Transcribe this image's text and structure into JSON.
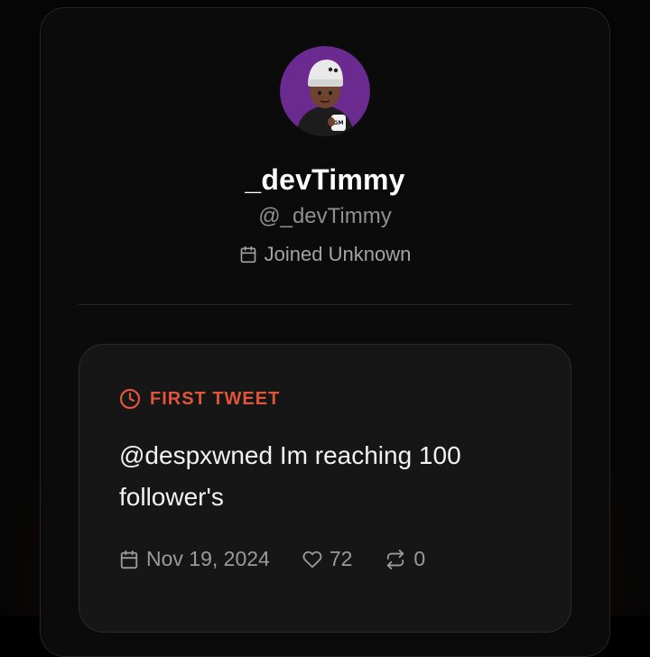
{
  "profile": {
    "display_name": "_devTimmy",
    "handle": "@_devTimmy",
    "joined": "Joined Unknown",
    "avatar_icon": "avatar-image",
    "avatar_bg": "#6b2a8f"
  },
  "first_tweet": {
    "label": "FIRST TWEET",
    "label_icon": "clock-icon",
    "accent": "#e0553a",
    "text": "@despxwned Im reaching 100 follower's",
    "date": "Nov 19, 2024",
    "likes": "72",
    "retweets": "0"
  }
}
